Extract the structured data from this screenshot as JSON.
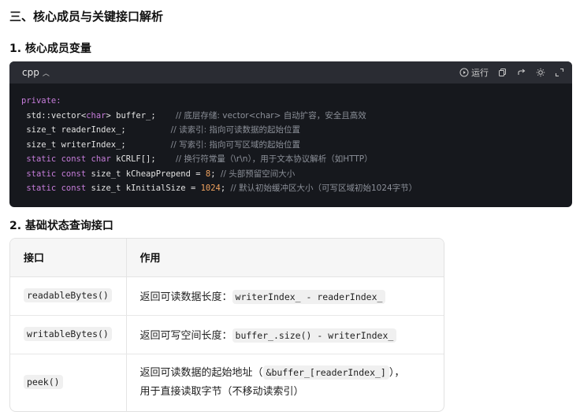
{
  "section_title": "三、核心成员与关键接口解析",
  "subsection1": "1. 核心成员变量",
  "code_block": {
    "language": "cpp",
    "run_label": "运行",
    "lines": {
      "l1_kw": "private:",
      "l2_code_a": " std::vector<",
      "l2_type": "char",
      "l2_code_b": "> buffer_;    ",
      "l2_comment": "// 底层存储: vector<char> 自动扩容，安全且高效",
      "l3_code": " size_t readerIndex_;         ",
      "l3_comment": "// 读索引: 指向可读数据的起始位置",
      "l4_code": " size_t writerIndex_;         ",
      "l4_comment": "// 写索引: 指向可写区域的起始位置",
      "l5_kw": " static const char",
      "l5_code": " kCRLF[];    ",
      "l5_comment": "// 换行符常量（\\r\\n），用于文本协议解析（如HTTP）",
      "l6_kw": " static const",
      "l6_code": " size_t kCheapPrepend = ",
      "l6_num": "8",
      "l6_tail": "; ",
      "l6_comment": "// 头部预留空间大小",
      "l7_kw": " static const",
      "l7_code": " size_t kInitialSize = ",
      "l7_num": "1024",
      "l7_tail": "; ",
      "l7_comment": "// 默认初始缓冲区大小（可写区域初始1024字节）"
    }
  },
  "subsection2": "2. 基础状态查询接口",
  "table": {
    "headers": [
      "接口",
      "作用"
    ],
    "rows": [
      {
        "iface": "readableBytes()",
        "desc_text": "返回可读数据长度：",
        "desc_code": "writerIndex_ - readerIndex_"
      },
      {
        "iface": "writableBytes()",
        "desc_text": "返回可写空间长度：",
        "desc_code": "buffer_.size() - writerIndex_"
      },
      {
        "iface": "peek()",
        "desc_text": "返回可读数据的起始地址（",
        "desc_code": "&buffer_[readerIndex_]",
        "desc_text2": "），",
        "desc_line2": "用于直接读取字节（不移动读索引）"
      }
    ]
  },
  "colors": {
    "code_bg": "#16181d",
    "code_header": "#2a2c33",
    "keyword": "#c77ddb",
    "number": "#f0a25e",
    "comment": "#8b8f98"
  },
  "icons": [
    "chevron-up-icon",
    "play-circle-icon",
    "copy-icon",
    "share-icon",
    "sun-icon",
    "expand-icon"
  ]
}
